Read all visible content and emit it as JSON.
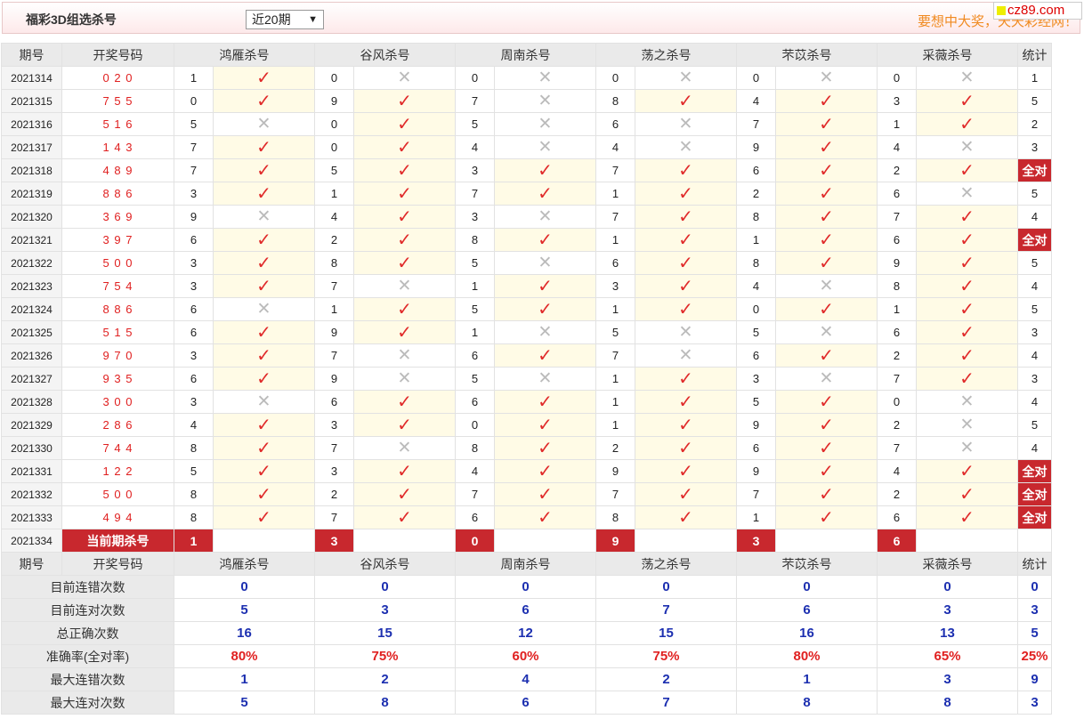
{
  "header": {
    "title": "福彩3D组选杀号",
    "period_select": "近20期",
    "slogan": "要想中大奖，天天彩经网！",
    "brand": "cz89.com"
  },
  "columns": {
    "issue": "期号",
    "draw": "开奖号码",
    "experts": [
      "鸿雁杀号",
      "谷风杀号",
      "周南杀号",
      "荡之杀号",
      "芣苡杀号",
      "采薇杀号"
    ],
    "count": "统计"
  },
  "colors": {
    "accent": "#c8282e",
    "check": "#e02a2a",
    "stat": "#1c2fb0"
  },
  "rows": [
    {
      "issue": "2021314",
      "draw": "0 2 0",
      "kills": [
        [
          1,
          true
        ],
        [
          0,
          false
        ],
        [
          0,
          false
        ],
        [
          0,
          false
        ],
        [
          0,
          false
        ],
        [
          0,
          false
        ]
      ],
      "count": "1"
    },
    {
      "issue": "2021315",
      "draw": "7 5 5",
      "kills": [
        [
          0,
          true
        ],
        [
          9,
          true
        ],
        [
          7,
          false
        ],
        [
          8,
          true
        ],
        [
          4,
          true
        ],
        [
          3,
          true
        ]
      ],
      "count": "5"
    },
    {
      "issue": "2021316",
      "draw": "5 1 6",
      "kills": [
        [
          5,
          false
        ],
        [
          0,
          true
        ],
        [
          5,
          false
        ],
        [
          6,
          false
        ],
        [
          7,
          true
        ],
        [
          1,
          true
        ]
      ],
      "count": "2"
    },
    {
      "issue": "2021317",
      "draw": "1 4 3",
      "kills": [
        [
          7,
          true
        ],
        [
          0,
          true
        ],
        [
          4,
          false
        ],
        [
          4,
          false
        ],
        [
          9,
          true
        ],
        [
          4,
          false
        ]
      ],
      "count": "3"
    },
    {
      "issue": "2021318",
      "draw": "4 8 9",
      "kills": [
        [
          7,
          true
        ],
        [
          5,
          true
        ],
        [
          3,
          true
        ],
        [
          7,
          true
        ],
        [
          6,
          true
        ],
        [
          2,
          true
        ]
      ],
      "count": "全对"
    },
    {
      "issue": "2021319",
      "draw": "8 8 6",
      "kills": [
        [
          3,
          true
        ],
        [
          1,
          true
        ],
        [
          7,
          true
        ],
        [
          1,
          true
        ],
        [
          2,
          true
        ],
        [
          6,
          false
        ]
      ],
      "count": "5"
    },
    {
      "issue": "2021320",
      "draw": "3 6 9",
      "kills": [
        [
          9,
          false
        ],
        [
          4,
          true
        ],
        [
          3,
          false
        ],
        [
          7,
          true
        ],
        [
          8,
          true
        ],
        [
          7,
          true
        ]
      ],
      "count": "4"
    },
    {
      "issue": "2021321",
      "draw": "3 9 7",
      "kills": [
        [
          6,
          true
        ],
        [
          2,
          true
        ],
        [
          8,
          true
        ],
        [
          1,
          true
        ],
        [
          1,
          true
        ],
        [
          6,
          true
        ]
      ],
      "count": "全对"
    },
    {
      "issue": "2021322",
      "draw": "5 0 0",
      "kills": [
        [
          3,
          true
        ],
        [
          8,
          true
        ],
        [
          5,
          false
        ],
        [
          6,
          true
        ],
        [
          8,
          true
        ],
        [
          9,
          true
        ]
      ],
      "count": "5"
    },
    {
      "issue": "2021323",
      "draw": "7 5 4",
      "kills": [
        [
          3,
          true
        ],
        [
          7,
          false
        ],
        [
          1,
          true
        ],
        [
          3,
          true
        ],
        [
          4,
          false
        ],
        [
          8,
          true
        ]
      ],
      "count": "4"
    },
    {
      "issue": "2021324",
      "draw": "8 8 6",
      "kills": [
        [
          6,
          false
        ],
        [
          1,
          true
        ],
        [
          5,
          true
        ],
        [
          1,
          true
        ],
        [
          0,
          true
        ],
        [
          1,
          true
        ]
      ],
      "count": "5"
    },
    {
      "issue": "2021325",
      "draw": "5 1 5",
      "kills": [
        [
          6,
          true
        ],
        [
          9,
          true
        ],
        [
          1,
          false
        ],
        [
          5,
          false
        ],
        [
          5,
          false
        ],
        [
          6,
          true
        ]
      ],
      "count": "3"
    },
    {
      "issue": "2021326",
      "draw": "9 7 0",
      "kills": [
        [
          3,
          true
        ],
        [
          7,
          false
        ],
        [
          6,
          true
        ],
        [
          7,
          false
        ],
        [
          6,
          true
        ],
        [
          2,
          true
        ]
      ],
      "count": "4"
    },
    {
      "issue": "2021327",
      "draw": "9 3 5",
      "kills": [
        [
          6,
          true
        ],
        [
          9,
          false
        ],
        [
          5,
          false
        ],
        [
          1,
          true
        ],
        [
          3,
          false
        ],
        [
          7,
          true
        ]
      ],
      "count": "3"
    },
    {
      "issue": "2021328",
      "draw": "3 0 0",
      "kills": [
        [
          3,
          false
        ],
        [
          6,
          true
        ],
        [
          6,
          true
        ],
        [
          1,
          true
        ],
        [
          5,
          true
        ],
        [
          0,
          false
        ]
      ],
      "count": "4"
    },
    {
      "issue": "2021329",
      "draw": "2 8 6",
      "kills": [
        [
          4,
          true
        ],
        [
          3,
          true
        ],
        [
          0,
          true
        ],
        [
          1,
          true
        ],
        [
          9,
          true
        ],
        [
          2,
          false
        ]
      ],
      "count": "5"
    },
    {
      "issue": "2021330",
      "draw": "7 4 4",
      "kills": [
        [
          8,
          true
        ],
        [
          7,
          false
        ],
        [
          8,
          true
        ],
        [
          2,
          true
        ],
        [
          6,
          true
        ],
        [
          7,
          false
        ]
      ],
      "count": "4"
    },
    {
      "issue": "2021331",
      "draw": "1 2 2",
      "kills": [
        [
          5,
          true
        ],
        [
          3,
          true
        ],
        [
          4,
          true
        ],
        [
          9,
          true
        ],
        [
          9,
          true
        ],
        [
          4,
          true
        ]
      ],
      "count": "全对"
    },
    {
      "issue": "2021332",
      "draw": "5 0 0",
      "kills": [
        [
          8,
          true
        ],
        [
          2,
          true
        ],
        [
          7,
          true
        ],
        [
          7,
          true
        ],
        [
          7,
          true
        ],
        [
          2,
          true
        ]
      ],
      "count": "全对"
    },
    {
      "issue": "2021333",
      "draw": "4 9 4",
      "kills": [
        [
          8,
          true
        ],
        [
          7,
          true
        ],
        [
          6,
          true
        ],
        [
          8,
          true
        ],
        [
          1,
          true
        ],
        [
          6,
          true
        ]
      ],
      "count": "全对"
    }
  ],
  "current": {
    "issue": "2021334",
    "label": "当前期杀号",
    "kills": [
      "1",
      "3",
      "0",
      "9",
      "3",
      "6"
    ]
  },
  "stats": [
    {
      "label": "目前连错次数",
      "values": [
        "0",
        "0",
        "0",
        "0",
        "0",
        "0"
      ],
      "total": "0",
      "red": false
    },
    {
      "label": "目前连对次数",
      "values": [
        "5",
        "3",
        "6",
        "7",
        "6",
        "3"
      ],
      "total": "3",
      "red": false
    },
    {
      "label": "总正确次数",
      "values": [
        "16",
        "15",
        "12",
        "15",
        "16",
        "13"
      ],
      "total": "5",
      "red": false
    },
    {
      "label": "准确率(全对率)",
      "values": [
        "80%",
        "75%",
        "60%",
        "75%",
        "80%",
        "65%"
      ],
      "total": "25%",
      "red": true
    },
    {
      "label": "最大连错次数",
      "values": [
        "1",
        "2",
        "4",
        "2",
        "1",
        "3"
      ],
      "total": "9",
      "red": false
    },
    {
      "label": "最大连对次数",
      "values": [
        "5",
        "8",
        "6",
        "7",
        "8",
        "8"
      ],
      "total": "3",
      "red": false
    }
  ]
}
